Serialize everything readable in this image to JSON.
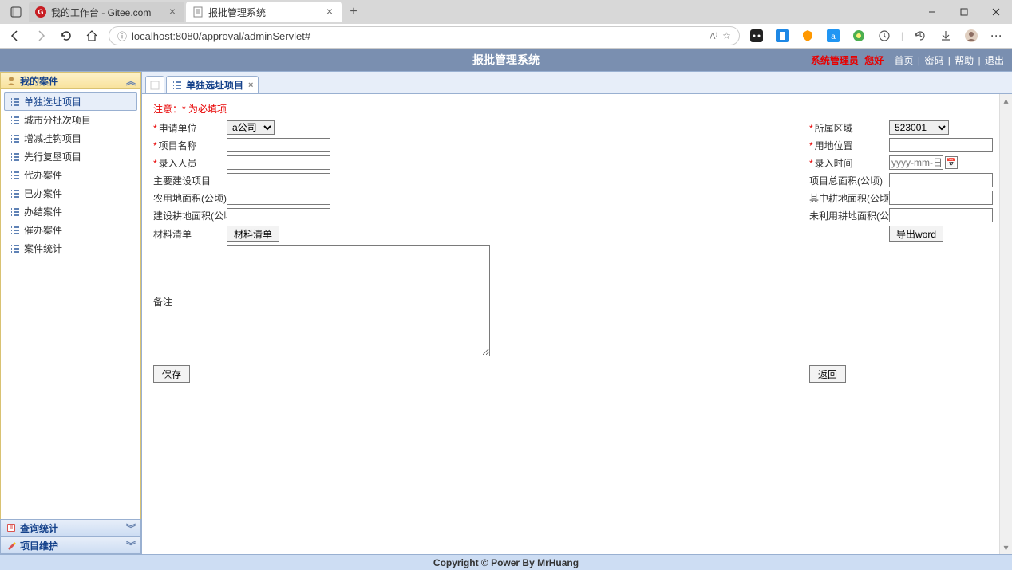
{
  "browser": {
    "tabs": [
      {
        "title": "我的工作台 - Gitee.com",
        "favicon": "gitee"
      },
      {
        "title": "报批管理系统",
        "favicon": "doc"
      }
    ],
    "url": "localhost:8080/approval/adminServlet#"
  },
  "header": {
    "title": "报批管理系统",
    "user_role_name": "系统管理员",
    "greeting": "您好",
    "links": [
      "首页",
      "密码",
      "帮助",
      "退出"
    ]
  },
  "sidebar": {
    "panels": [
      {
        "title": "我的案件",
        "expanded": true,
        "icon": "user",
        "items": [
          {
            "label": "单独选址项目",
            "active": true
          },
          {
            "label": "城市分批次项目"
          },
          {
            "label": "增减挂钩项目"
          },
          {
            "label": "先行复垦项目"
          },
          {
            "label": "代办案件"
          },
          {
            "label": "已办案件"
          },
          {
            "label": "办结案件"
          },
          {
            "label": "催办案件"
          },
          {
            "label": "案件统计"
          }
        ]
      },
      {
        "title": "查询统计",
        "expanded": false,
        "icon": "book"
      },
      {
        "title": "项目维护",
        "expanded": false,
        "icon": "tools"
      }
    ]
  },
  "main": {
    "open_tab_label": "单独选址项目",
    "notice": "注意：* 为必填项",
    "form": {
      "apply_unit_label": "申请单位",
      "apply_unit_value": "a公司",
      "region_label": "所属区域",
      "region_value": "523001",
      "project_name_label": "项目名称",
      "land_location_label": "用地位置",
      "entry_person_label": "录入人员",
      "entry_time_label": "录入时间",
      "entry_time_placeholder": "yyyy-mm-日",
      "main_build_label": "主要建设项目",
      "total_area_label": "项目总面积(公顷)",
      "farm_area_label": "农用地面积(公顷)",
      "plow_area_label": "其中耕地面积(公顷)",
      "build_plow_label": "建设耕地面积(公顷)",
      "unused_plow_label": "未利用耕地面积(公顷)",
      "material_list_label": "材料清单",
      "material_list_btn": "材料清单",
      "export_word_btn": "导出word",
      "remark_label": "备注",
      "save_btn": "保存",
      "back_btn": "返回"
    }
  },
  "footer": "Copyright © Power By MrHuang"
}
